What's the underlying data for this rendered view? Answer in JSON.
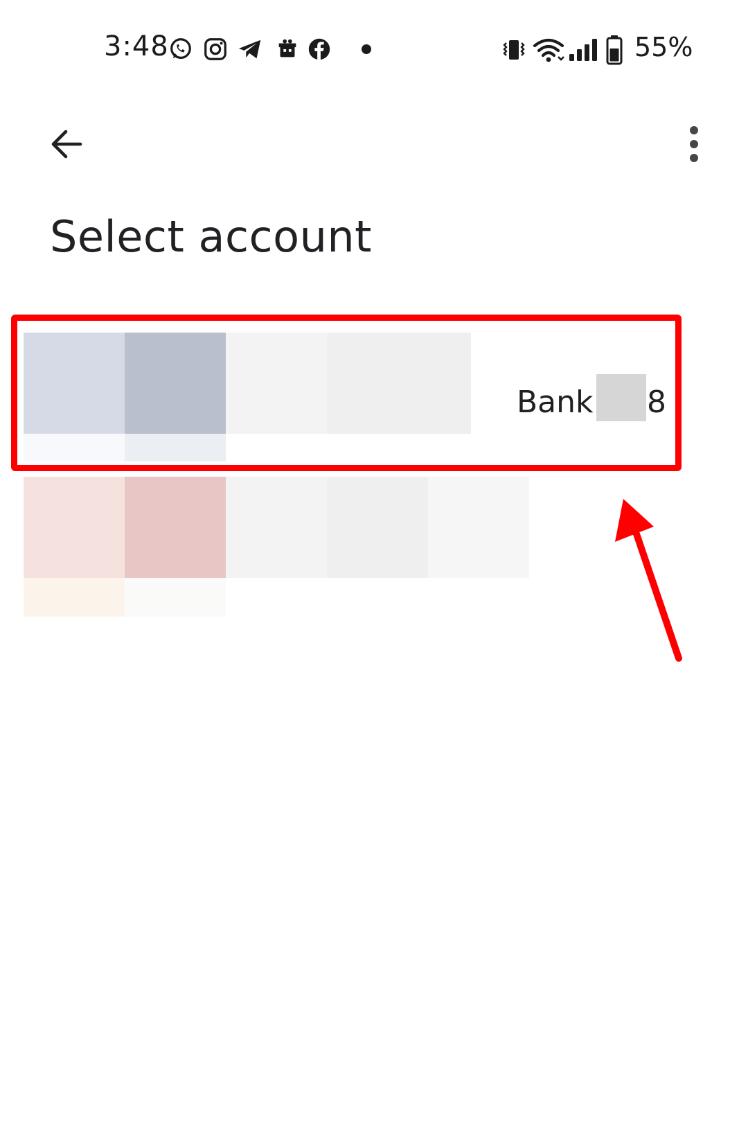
{
  "status_bar": {
    "time": "3:48",
    "notification_icons": [
      "whatsapp-icon",
      "instagram-icon",
      "telegram-icon",
      "gift-icon",
      "facebook-icon",
      "more-notifications-dot"
    ],
    "system_icons": [
      "vibrate-icon",
      "wifi-icon",
      "signal-icon",
      "battery-icon"
    ],
    "battery_percent": "55%"
  },
  "app_bar": {
    "back_icon": "arrow-back-icon",
    "menu_icon": "more-vert-icon"
  },
  "page": {
    "title": "Select account"
  },
  "accounts": [
    {
      "name_prefix": "Bank",
      "name_suffix": "8",
      "redacted": true,
      "logo_palette": [
        "#d5dae6",
        "#babfcd",
        "#f3f3f3",
        "#efefef",
        "#f7f9fc",
        "#ebeef2"
      ]
    },
    {
      "name_prefix": "",
      "name_suffix": "",
      "redacted": true,
      "logo_palette": [
        "#f5e2df",
        "#e8c6c5",
        "#f3f3f3",
        "#efefef",
        "#f6f6f6",
        "#fcf4ea",
        "#fafaf9"
      ]
    }
  ],
  "annotations": {
    "highlight_color": "#ff0000"
  }
}
